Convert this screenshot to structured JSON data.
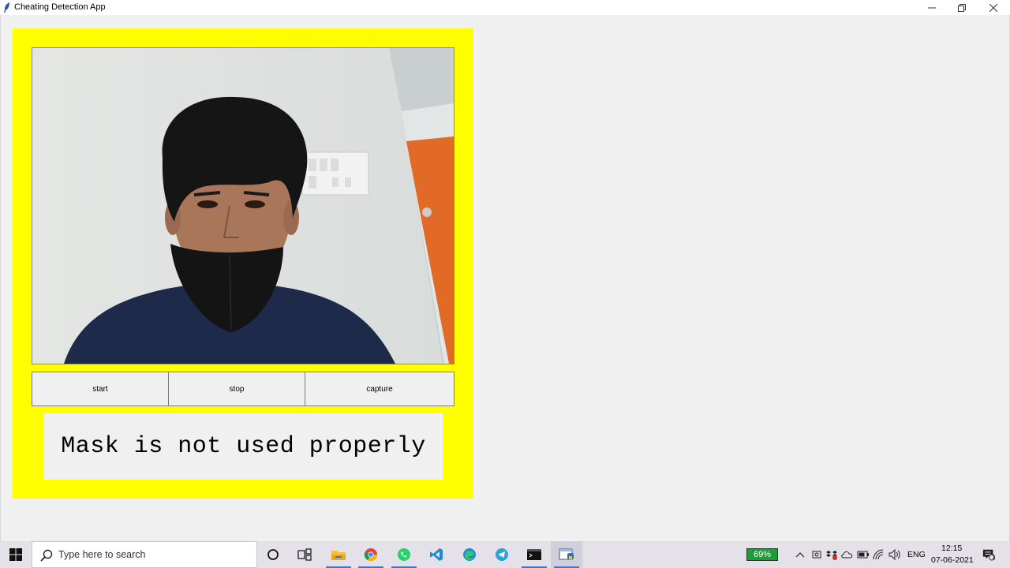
{
  "window": {
    "title": "Cheating Detection App",
    "controls": [
      "minimize-icon",
      "restore-icon",
      "close-icon"
    ]
  },
  "colors": {
    "panel_background": "#ffff00",
    "window_background": "#f0f0f0",
    "taskbar_background": "#e4e2e8",
    "battery_badge": "#1e9c3a"
  },
  "camera": {
    "icon": "webcam-feed-image"
  },
  "buttons": {
    "start_label": "start",
    "stop_label": "stop",
    "capture_label": "capture"
  },
  "status": {
    "message": "Mask is not used properly"
  },
  "taskbar": {
    "search_placeholder": "Type here to search",
    "pinned_apps": [
      "cortana-icon",
      "task-view-icon",
      "file-explorer-icon",
      "chrome-icon",
      "whatsapp-icon",
      "vscode-icon",
      "edge-icon",
      "telegram-icon",
      "terminal-icon",
      "python-app-icon"
    ],
    "battery_percent": "69%",
    "language": "ENG",
    "time": "12:15",
    "date": "07-06-2021",
    "notification_count": "1"
  }
}
